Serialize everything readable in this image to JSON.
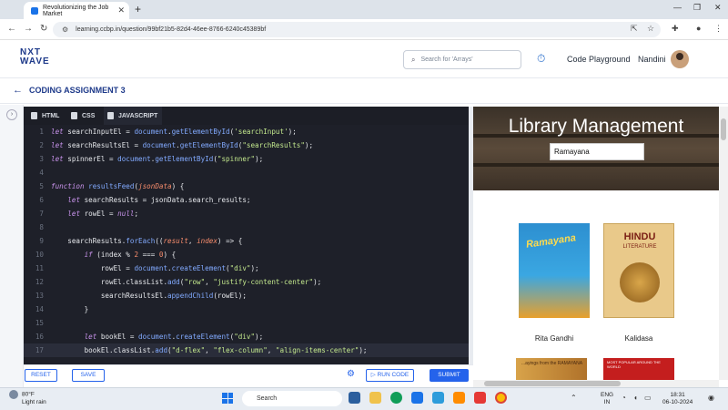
{
  "browser": {
    "tab_title": "Revolutionizing the Job Market",
    "url": "learning.ccbp.in/question/99bf21b5-82d4-46ee-8766-6240c45389bf"
  },
  "header": {
    "logo_line1": "NXT",
    "logo_line2": "WAVE",
    "search_placeholder": "Search for 'Arrays'",
    "code_playground": "Code Playground",
    "user_name": "Nandini"
  },
  "page": {
    "title": "CODING ASSIGNMENT 3"
  },
  "editor": {
    "tabs": [
      "HTML",
      "CSS",
      "JAVASCRIPT"
    ],
    "active_tab": "JAVASCRIPT",
    "lines": [
      {
        "n": "1",
        "html": "<span class='kw'>let</span> searchInputEl = <span class='fn'>document</span>.<span class='fn'>getElementById</span>(<span class='str'>'searchInput'</span>);"
      },
      {
        "n": "2",
        "html": "<span class='kw'>let</span> searchResultsEl = <span class='fn'>document</span>.<span class='fn'>getElementById</span>(<span class='str'>\"searchResults\"</span>);"
      },
      {
        "n": "3",
        "html": "<span class='kw'>let</span> spinnerEl = <span class='fn'>document</span>.<span class='fn'>getElementById</span>(<span class='str'>\"spinner\"</span>);"
      },
      {
        "n": "4",
        "html": ""
      },
      {
        "n": "5",
        "html": "<span class='kw'>function</span> <span class='fn'>resultsFeed</span>(<span class='prm'>jsonData</span>) {"
      },
      {
        "n": "6",
        "html": "    <span class='kw'>let</span> searchResults = jsonData.search_results;"
      },
      {
        "n": "7",
        "html": "    <span class='kw'>let</span> rowEl = <span class='kw'>null</span>;"
      },
      {
        "n": "8",
        "html": ""
      },
      {
        "n": "9",
        "html": "    searchResults.<span class='fn'>forEach</span>((<span class='prm'>result</span>, <span class='prm'>index</span>) => {"
      },
      {
        "n": "10",
        "html": "        <span class='kw'>if</span> (index % <span class='num'>2</span> === <span class='num'>0</span>) {"
      },
      {
        "n": "11",
        "html": "            rowEl = <span class='fn'>document</span>.<span class='fn'>createElement</span>(<span class='str'>\"div\"</span>);"
      },
      {
        "n": "12",
        "html": "            rowEl.classList.<span class='fn'>add</span>(<span class='str'>\"row\"</span>, <span class='str'>\"justify-content-center\"</span>);"
      },
      {
        "n": "13",
        "html": "            searchResultsEl.<span class='fn'>appendChild</span>(rowEl);"
      },
      {
        "n": "14",
        "html": "        }"
      },
      {
        "n": "15",
        "html": ""
      },
      {
        "n": "16",
        "html": "        <span class='kw'>let</span> bookEl = <span class='fn'>document</span>.<span class='fn'>createElement</span>(<span class='str'>\"div\"</span>);"
      },
      {
        "n": "17",
        "html": "        bookEl.classList.<span class='fn'>add</span>(<span class='str'>\"d-flex\"</span>, <span class='str'>\"flex-column\"</span>, <span class='str'>\"align-items-center\"</span>);"
      }
    ]
  },
  "preview": {
    "heading": "Library Management",
    "search_value": "Ramayana",
    "books": [
      {
        "cover_text": "Ramayana",
        "author": "Rita Gandhi"
      },
      {
        "cover_text": "HINDU",
        "cover_sub": "LITERATURE",
        "author": "Kalidasa"
      }
    ],
    "book3_text": "...ayings from the RAMAYANA",
    "book4_text": "MOST POPULAR AROUND THE WORLD"
  },
  "actions": {
    "reset": "RESET",
    "save": "SAVE",
    "run_code": "RUN CODE",
    "submit": "SUBMIT"
  },
  "taskbar": {
    "temperature": "80°F",
    "weather": "Light rain",
    "search": "Search",
    "lang1": "ENG",
    "lang2": "IN",
    "time": "18:31",
    "date": "06-10-2024"
  }
}
